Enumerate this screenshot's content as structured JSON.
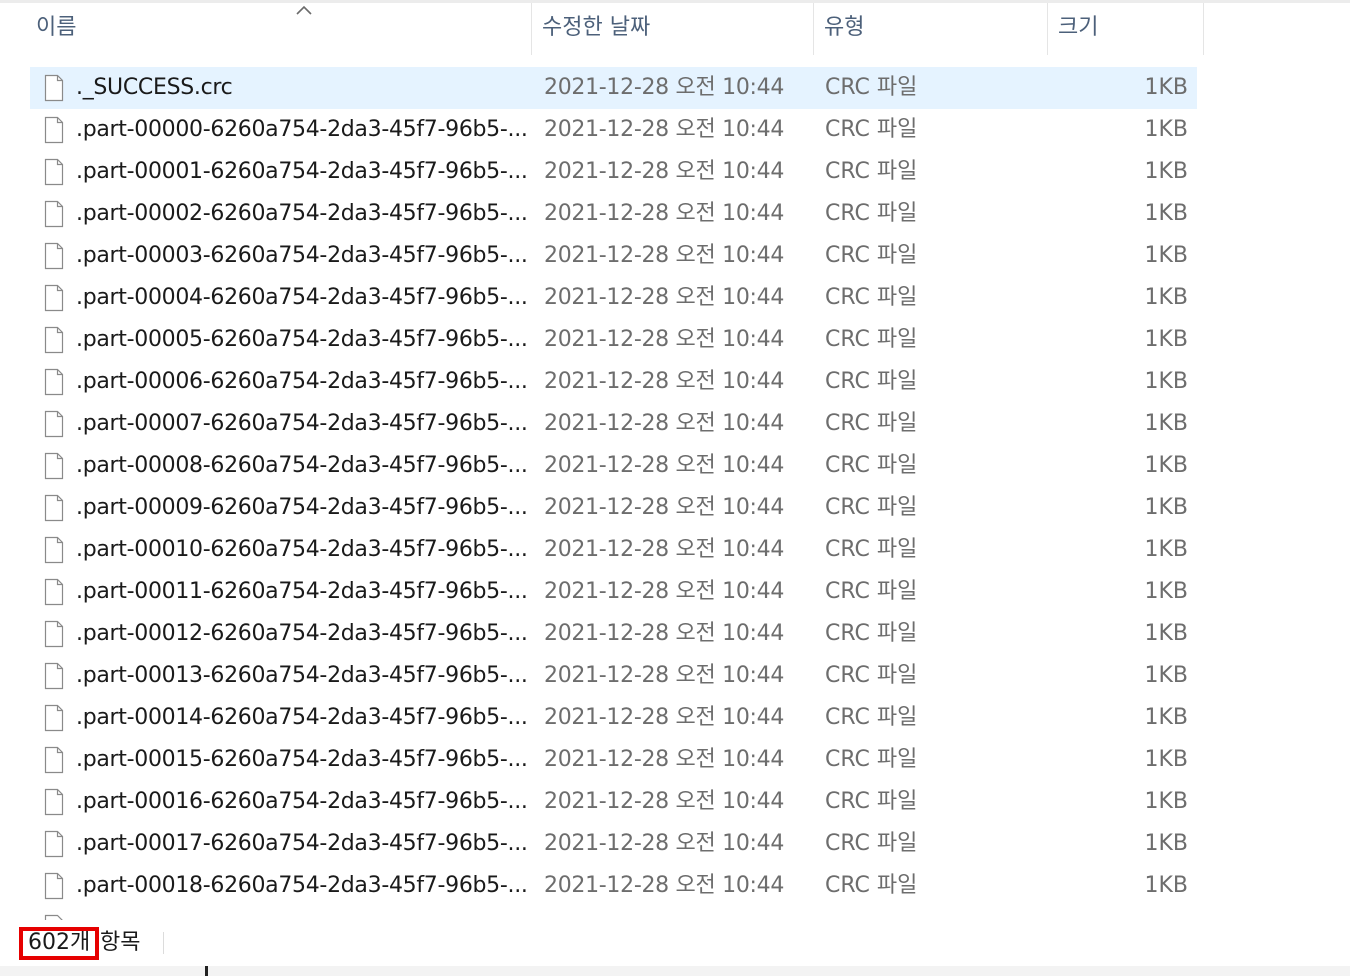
{
  "columns": {
    "name": "이름",
    "date": "수정한 날짜",
    "type": "유형",
    "size": "크기"
  },
  "sort_icon": "chevron-up-icon",
  "file_icon": "blank-file-icon",
  "files": [
    {
      "name": "._SUCCESS.crc",
      "date": "2021-12-28 오전 10:44",
      "type": "CRC 파일",
      "size": "1KB",
      "selected": true
    },
    {
      "name": ".part-00000-6260a754-2da3-45f7-96b5-...",
      "date": "2021-12-28 오전 10:44",
      "type": "CRC 파일",
      "size": "1KB"
    },
    {
      "name": ".part-00001-6260a754-2da3-45f7-96b5-...",
      "date": "2021-12-28 오전 10:44",
      "type": "CRC 파일",
      "size": "1KB"
    },
    {
      "name": ".part-00002-6260a754-2da3-45f7-96b5-...",
      "date": "2021-12-28 오전 10:44",
      "type": "CRC 파일",
      "size": "1KB"
    },
    {
      "name": ".part-00003-6260a754-2da3-45f7-96b5-...",
      "date": "2021-12-28 오전 10:44",
      "type": "CRC 파일",
      "size": "1KB"
    },
    {
      "name": ".part-00004-6260a754-2da3-45f7-96b5-...",
      "date": "2021-12-28 오전 10:44",
      "type": "CRC 파일",
      "size": "1KB"
    },
    {
      "name": ".part-00005-6260a754-2da3-45f7-96b5-...",
      "date": "2021-12-28 오전 10:44",
      "type": "CRC 파일",
      "size": "1KB"
    },
    {
      "name": ".part-00006-6260a754-2da3-45f7-96b5-...",
      "date": "2021-12-28 오전 10:44",
      "type": "CRC 파일",
      "size": "1KB"
    },
    {
      "name": ".part-00007-6260a754-2da3-45f7-96b5-...",
      "date": "2021-12-28 오전 10:44",
      "type": "CRC 파일",
      "size": "1KB"
    },
    {
      "name": ".part-00008-6260a754-2da3-45f7-96b5-...",
      "date": "2021-12-28 오전 10:44",
      "type": "CRC 파일",
      "size": "1KB"
    },
    {
      "name": ".part-00009-6260a754-2da3-45f7-96b5-...",
      "date": "2021-12-28 오전 10:44",
      "type": "CRC 파일",
      "size": "1KB"
    },
    {
      "name": ".part-00010-6260a754-2da3-45f7-96b5-...",
      "date": "2021-12-28 오전 10:44",
      "type": "CRC 파일",
      "size": "1KB"
    },
    {
      "name": ".part-00011-6260a754-2da3-45f7-96b5-...",
      "date": "2021-12-28 오전 10:44",
      "type": "CRC 파일",
      "size": "1KB"
    },
    {
      "name": ".part-00012-6260a754-2da3-45f7-96b5-...",
      "date": "2021-12-28 오전 10:44",
      "type": "CRC 파일",
      "size": "1KB"
    },
    {
      "name": ".part-00013-6260a754-2da3-45f7-96b5-...",
      "date": "2021-12-28 오전 10:44",
      "type": "CRC 파일",
      "size": "1KB"
    },
    {
      "name": ".part-00014-6260a754-2da3-45f7-96b5-...",
      "date": "2021-12-28 오전 10:44",
      "type": "CRC 파일",
      "size": "1KB"
    },
    {
      "name": ".part-00015-6260a754-2da3-45f7-96b5-...",
      "date": "2021-12-28 오전 10:44",
      "type": "CRC 파일",
      "size": "1KB"
    },
    {
      "name": ".part-00016-6260a754-2da3-45f7-96b5-...",
      "date": "2021-12-28 오전 10:44",
      "type": "CRC 파일",
      "size": "1KB"
    },
    {
      "name": ".part-00017-6260a754-2da3-45f7-96b5-...",
      "date": "2021-12-28 오전 10:44",
      "type": "CRC 파일",
      "size": "1KB"
    },
    {
      "name": ".part-00018-6260a754-2da3-45f7-96b5-...",
      "date": "2021-12-28 오전 10:44",
      "type": "CRC 파일",
      "size": "1KB"
    }
  ],
  "status": {
    "count": "602개",
    "label": "항목"
  },
  "colors": {
    "selection": "#e5f3ff",
    "header_text": "#4c607a",
    "highlight_box": "#e60000"
  }
}
